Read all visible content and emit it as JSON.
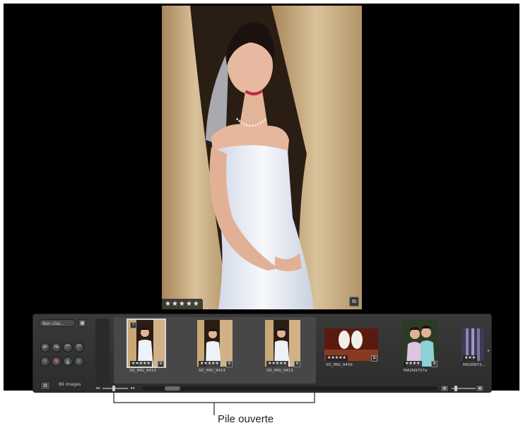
{
  "viewer": {
    "main_photo": {
      "rating": "★★★★★"
    }
  },
  "browser": {
    "filter_label": "Non clas...",
    "image_count": "89 images",
    "rating_buttons": [
      "rotate-left-icon",
      "rotate-right-icon",
      "pick-icon",
      "reject-icon",
      "remove-icon",
      "decrease-rating-icon",
      "increase-rating-icon",
      "approve-icon"
    ],
    "thumbnails": [
      {
        "name": "SD_IMG_9410",
        "rating": "★★★★★",
        "selected": true,
        "stack_badge": "3"
      },
      {
        "name": "SD_IMG_9414",
        "rating": "★★★★★",
        "selected": false
      },
      {
        "name": "SD_IMG_9415",
        "rating": "★★★★★",
        "selected": false
      },
      {
        "name": "SD_IMG_9456",
        "rating": "★★★★★",
        "selected": false
      },
      {
        "name": "MA2N9707a",
        "rating": "★★★★",
        "selected": false
      },
      {
        "name": "MA2N972...",
        "rating": "★★★",
        "selected": false
      }
    ]
  },
  "callout": {
    "label": "Pile ouverte"
  }
}
